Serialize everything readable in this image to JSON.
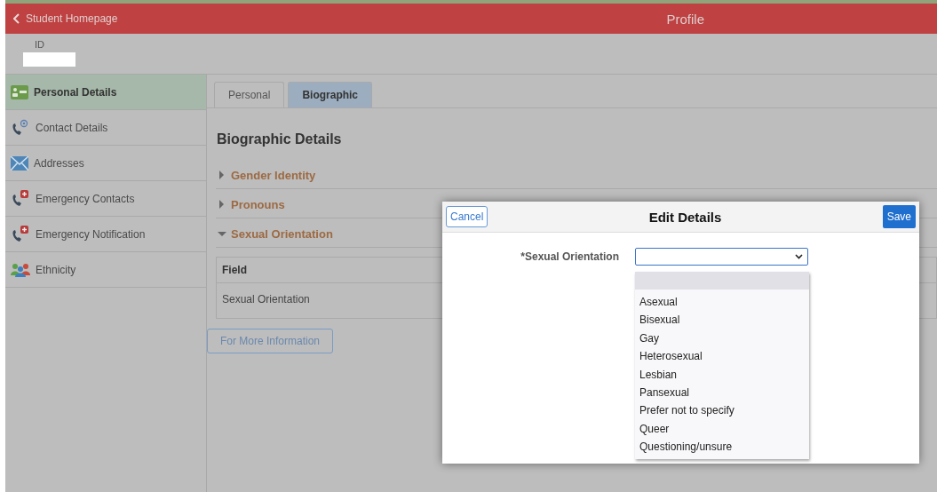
{
  "header": {
    "back_link": "Student Homepage",
    "title": "Profile"
  },
  "id_band": {
    "label": "ID"
  },
  "sidebar": {
    "items": [
      {
        "label": "Personal Details",
        "kind": "card",
        "selected": true
      },
      {
        "label": "Contact Details",
        "kind": "contact",
        "selected": false
      },
      {
        "label": "Addresses",
        "kind": "mail",
        "selected": false
      },
      {
        "label": "Emergency Contacts",
        "kind": "emergency",
        "selected": false
      },
      {
        "label": "Emergency Notification",
        "kind": "emergency",
        "selected": false
      },
      {
        "label": "Ethnicity",
        "kind": "people",
        "selected": false
      }
    ]
  },
  "tabs": [
    {
      "label": "Personal",
      "selected": false
    },
    {
      "label": "Biographic",
      "selected": true
    }
  ],
  "heading": "Biographic Details",
  "sections": [
    {
      "title": "Gender Identity",
      "expanded": false
    },
    {
      "title": "Pronouns",
      "expanded": false
    },
    {
      "title": "Sexual Orientation",
      "expanded": true,
      "table": {
        "columns": [
          "Field"
        ],
        "rows": [
          [
            "Sexual Orientation"
          ]
        ]
      }
    }
  ],
  "info_button": "For More Information",
  "modal": {
    "cancel": "Cancel",
    "title": "Edit Details",
    "save": "Save",
    "field": {
      "label": "*Sexual Orientation",
      "blank_option": {
        "highlighted": true
      },
      "options": [
        {
          "label": "Asexual",
          "highlighted": false
        },
        {
          "label": "Bisexual",
          "highlighted": false
        },
        {
          "label": "Gay",
          "highlighted": false
        },
        {
          "label": "Heterosexual",
          "highlighted": false
        },
        {
          "label": "Lesbian",
          "highlighted": false
        },
        {
          "label": "Pansexual",
          "highlighted": false
        },
        {
          "label": "Prefer not to specify",
          "highlighted": false
        },
        {
          "label": "Queer",
          "highlighted": false
        },
        {
          "label": "Questioning/unsure",
          "highlighted": false
        }
      ]
    }
  }
}
